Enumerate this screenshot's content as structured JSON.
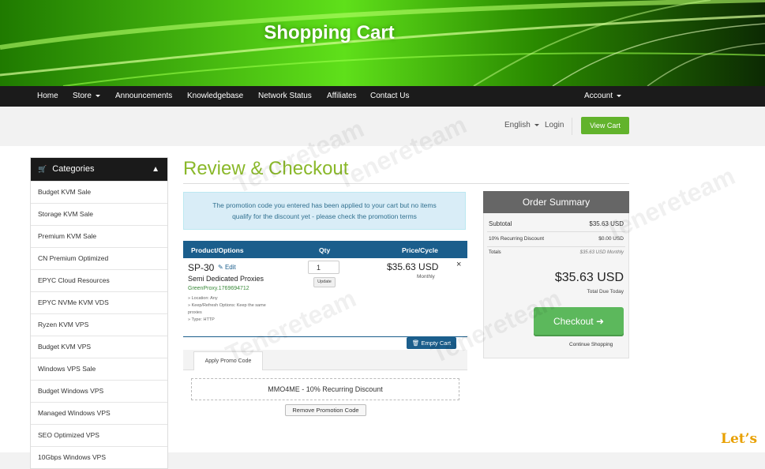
{
  "header": {
    "title": "Shopping Cart"
  },
  "nav": {
    "home": "Home",
    "store": "Store",
    "announcements": "Announcements",
    "knowledgebase": "Knowledgebase",
    "network_status": "Network Status",
    "affiliates": "Affiliates",
    "contact": "Contact Us",
    "account": "Account"
  },
  "topbar": {
    "language": "English",
    "login": "Login",
    "view_cart": "View Cart"
  },
  "sidebar": {
    "heading": "Categories",
    "items": [
      "Budget KVM Sale",
      "Storage KVM Sale",
      "Premium KVM Sale",
      "CN Premium Optimized",
      "EPYC Cloud Resources",
      "EPYC NVMe KVM VDS",
      "Ryzen KVM VPS",
      "Budget KVM VPS",
      "Windows VPS Sale",
      "Budget Windows VPS",
      "Managed Windows VPS",
      "SEO Optimized VPS",
      "10Gbps Windows VPS"
    ]
  },
  "main": {
    "title": "Review & Checkout",
    "alert_line1": "The promotion code you entered has been applied to your cart but no items",
    "alert_line2": "qualify for the discount yet - please check the promotion terms"
  },
  "cart_table": {
    "headers": {
      "product": "Product/Options",
      "qty": "Qty",
      "price": "Price/Cycle"
    },
    "item": {
      "name": "SP-30",
      "edit": "Edit",
      "group": "Semi Dedicated Proxies",
      "domain": "GreenProxy.1769694712",
      "options": [
        "» Location: Any",
        "» Keep/Refresh Options: Keep the same",
        "proxies",
        "» Type: HTTP"
      ],
      "qty": "1",
      "update": "Update",
      "price": "$35.63 USD",
      "cycle": "Monthly",
      "remove": "×"
    },
    "empty_cart": "Empty Cart"
  },
  "promo": {
    "tab": "Apply Promo Code",
    "code": "MMO4ME - 10% Recurring Discount",
    "remove": "Remove Promotion Code"
  },
  "summary": {
    "title": "Order Summary",
    "subtotal_label": "Subtotal",
    "subtotal_value": "$35.63 USD",
    "discount_label": "10% Recurring Discount",
    "discount_value": "$0.00 USD",
    "totals_label": "Totals",
    "totals_value": "$35.63 USD Monthly",
    "total": "$35.63 USD",
    "total_due": "Total Due Today",
    "checkout": "Checkout",
    "continue": "Continue Shopping"
  },
  "watermark": {
    "text": "Tenereteam",
    "lets": "Let’s"
  },
  "colors": {
    "accent_green": "#62b32c",
    "table_blue": "#1b5e8c",
    "title_green": "#8ab82a"
  }
}
